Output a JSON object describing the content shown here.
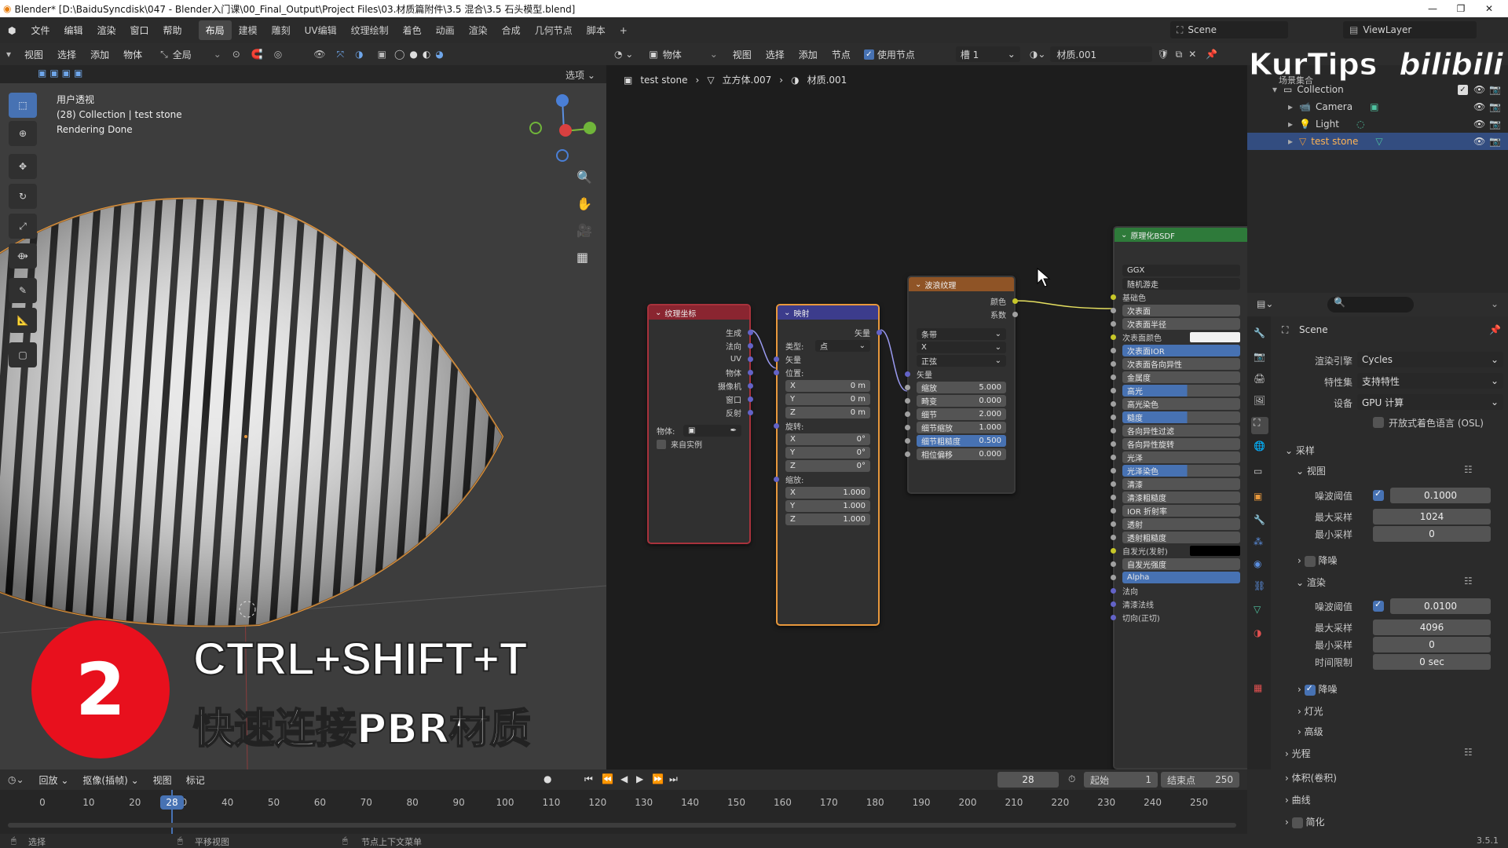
{
  "title_bar": {
    "text": "Blender* [D:\\BaiduSyncdisk\\047 - Blender入门课\\00_Final_Output\\Project Files\\03.材质篇附件\\3.5 混合\\3.5 石头模型.blend]"
  },
  "menus": [
    "文件",
    "编辑",
    "渲染",
    "窗口",
    "帮助"
  ],
  "workspaces": [
    "布局",
    "建模",
    "雕刻",
    "UV编辑",
    "纹理绘制",
    "着色",
    "动画",
    "渲染",
    "合成",
    "几何节点",
    "脚本"
  ],
  "active_workspace": "布局",
  "scene_name": "Scene",
  "view_layer": "ViewLayer",
  "viewport": {
    "header": [
      "视图",
      "选择",
      "添加",
      "物体"
    ],
    "transform_global": "全局",
    "options": "选项",
    "overlay_lines": [
      "用户透视",
      "(28) Collection | test stone",
      "Rendering Done"
    ]
  },
  "node_editor": {
    "header": {
      "object_mode": "物体",
      "menus": [
        "视图",
        "选择",
        "添加",
        "节点"
      ],
      "use_nodes": "使用节点",
      "slot": "槽 1",
      "material": "材质.001"
    },
    "breadcrumb": [
      "test stone",
      "立方体.007",
      "材质.001"
    ],
    "tex_coord": {
      "title": "纹理坐标",
      "outputs": [
        "生成",
        "法向",
        "UV",
        "物体",
        "摄像机",
        "窗口",
        "反射"
      ],
      "object_label": "物体:",
      "from_instancer": "来自实例"
    },
    "mapping": {
      "title": "映射",
      "output": "矢量",
      "type_label": "类型:",
      "type_value": "点",
      "vector": "矢量",
      "location": "位置:",
      "rotation": "旋转:",
      "scale": "缩放:",
      "loc": [
        [
          "X",
          "0 m"
        ],
        [
          "Y",
          "0 m"
        ],
        [
          "Z",
          "0 m"
        ]
      ],
      "rot": [
        [
          "X",
          "0°"
        ],
        [
          "Y",
          "0°"
        ],
        [
          "Z",
          "0°"
        ]
      ],
      "scl": [
        [
          "X",
          "1.000"
        ],
        [
          "Y",
          "1.000"
        ],
        [
          "Z",
          "1.000"
        ]
      ]
    },
    "wave": {
      "title": "波浪纹理",
      "outputs": [
        "颜色",
        "系数"
      ],
      "drop1": "条带",
      "drop2": "X",
      "drop3": "正弦",
      "vector": "矢量",
      "fields": [
        [
          "缩放",
          "5.000"
        ],
        [
          "畸变",
          "0.000"
        ],
        [
          "细节",
          "2.000"
        ],
        [
          "细节缩放",
          "1.000"
        ],
        [
          "细节粗糙度",
          "0.500"
        ],
        [
          "相位偏移",
          "0.000"
        ]
      ]
    },
    "bsdf": {
      "title": "原理化BSDF",
      "distribution": "GGX",
      "subsurface_method": "随机游走",
      "inputs": [
        "基础色",
        "次表面",
        "次表面半径",
        "次表面颜色",
        "次表面IOR",
        "次表面各向异性",
        "金属度",
        "高光",
        "高光染色",
        "糙度",
        "各向异性过滤",
        "各向异性旋转",
        "光泽",
        "光泽染色",
        "清漆",
        "清漆粗糙度",
        "IOR 折射率",
        "透射",
        "透射粗糙度",
        "自发光(发射)",
        "自发光强度",
        "Alpha",
        "法向",
        "清漆法线",
        "切向(正切)"
      ]
    }
  },
  "outliner": {
    "root": "场景集合",
    "collection": "Collection",
    "items": [
      "Camera",
      "Light",
      "test stone"
    ]
  },
  "watermark": {
    "left": "KurTips",
    "right": "bilibili"
  },
  "overlay": {
    "step": "2",
    "shortcut": "CTRL+SHIFT+T",
    "desc": "快速连接PBR材质"
  },
  "properties": {
    "scene": "Scene",
    "engine_label": "渲染引擎",
    "engine": "Cycles",
    "feature_label": "特性集",
    "feature": "支持特性",
    "device_label": "设备",
    "device": "GPU 计算",
    "osl": "开放式着色语言 (OSL)",
    "sampling": "采样",
    "viewport": "视图",
    "noise_threshold": "噪波阈值",
    "v_noise": "0.1000",
    "max_samples": "最大采样",
    "v_max": "1024",
    "min_samples": "最小采样",
    "v_min": "0",
    "denoise": "降噪",
    "render": "渲染",
    "r_noise": "0.0100",
    "r_max": "4096",
    "r_min": "0",
    "time_limit": "时间限制",
    "r_time": "0 sec",
    "lights": "灯光",
    "advanced": "高级",
    "light_paths": "光程",
    "volumes": "体积(卷积)",
    "curves": "曲线",
    "simplify": "简化"
  },
  "timeline": {
    "menus": [
      "回放",
      "抠像(插帧)",
      "视图",
      "标记"
    ],
    "current": "28",
    "start_label": "起始",
    "start": "1",
    "end_label": "结束点",
    "end": "250",
    "ticks": [
      "0",
      "10",
      "20",
      "30",
      "40",
      "50",
      "60",
      "70",
      "80",
      "90",
      "100",
      "110",
      "120",
      "130",
      "140",
      "150",
      "160",
      "170",
      "180",
      "190",
      "200",
      "210",
      "220",
      "230",
      "240",
      "250"
    ]
  },
  "status": {
    "select": "选择",
    "pan": "平移视图",
    "context": "节点上下文菜单",
    "version": "3.5.1"
  },
  "colors": {
    "accent": "#4772b3",
    "tex_header": "#8a2530",
    "vector_header": "#3c3c8c",
    "wave_header": "#8f5426",
    "shader_header": "#2e7a3a",
    "selection_orange": "#e8983c"
  }
}
